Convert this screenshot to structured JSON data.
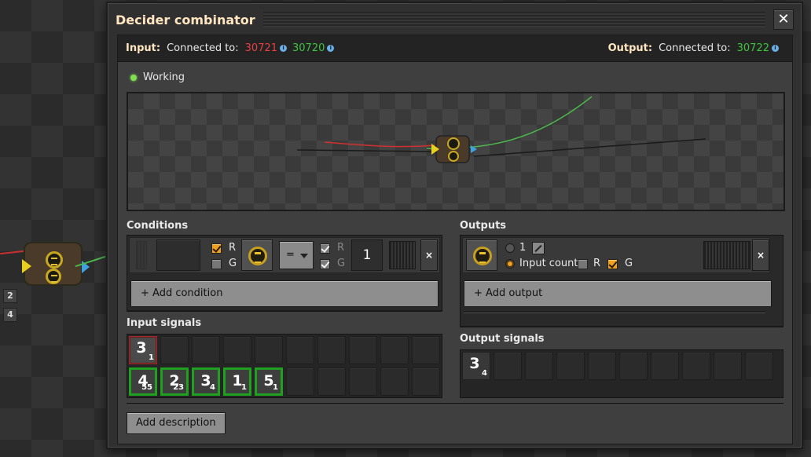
{
  "window": {
    "title": "Decider combinator",
    "close_label": "✕"
  },
  "connection": {
    "input_label": "Input:",
    "input_connected_label": "Connected to:",
    "input_red_id": "30721",
    "input_green_id": "30720",
    "output_label": "Output:",
    "output_connected_label": "Connected to:",
    "output_green_id": "30722",
    "info_glyph": "i"
  },
  "status": {
    "text": "Working",
    "color": "#7ee050"
  },
  "conditions": {
    "title": "Conditions",
    "red_label": "R",
    "green_label": "G",
    "red_checked": true,
    "green_checked": false,
    "comparator": "=",
    "right_red_label": "R",
    "right_green_label": "G",
    "constant": "1",
    "remove_label": "×",
    "add_label": "+ Add condition"
  },
  "outputs": {
    "title": "Outputs",
    "value_option": "1",
    "input_count_option": "Input count",
    "red_label": "R",
    "green_label": "G",
    "red_checked": false,
    "green_checked": true,
    "remove_label": "×",
    "add_label": "+ Add output"
  },
  "input_signals": {
    "title": "Input signals",
    "red": [
      {
        "big": "3",
        "small": "1"
      }
    ],
    "green": [
      {
        "big": "4",
        "small": "55"
      },
      {
        "big": "2",
        "small": "23"
      },
      {
        "big": "3",
        "small": "4"
      },
      {
        "big": "1",
        "small": "1"
      },
      {
        "big": "5",
        "small": "1"
      }
    ]
  },
  "output_signals": {
    "title": "Output signals",
    "signals": [
      {
        "big": "3",
        "small": "4"
      }
    ]
  },
  "description_button": "Add description",
  "world_badges": [
    "2",
    "4"
  ],
  "colors": {
    "title": "#ffe6c0",
    "red_wire": "#e84040",
    "green_wire": "#3ec43e",
    "checkbox_on": "#f0a020"
  }
}
